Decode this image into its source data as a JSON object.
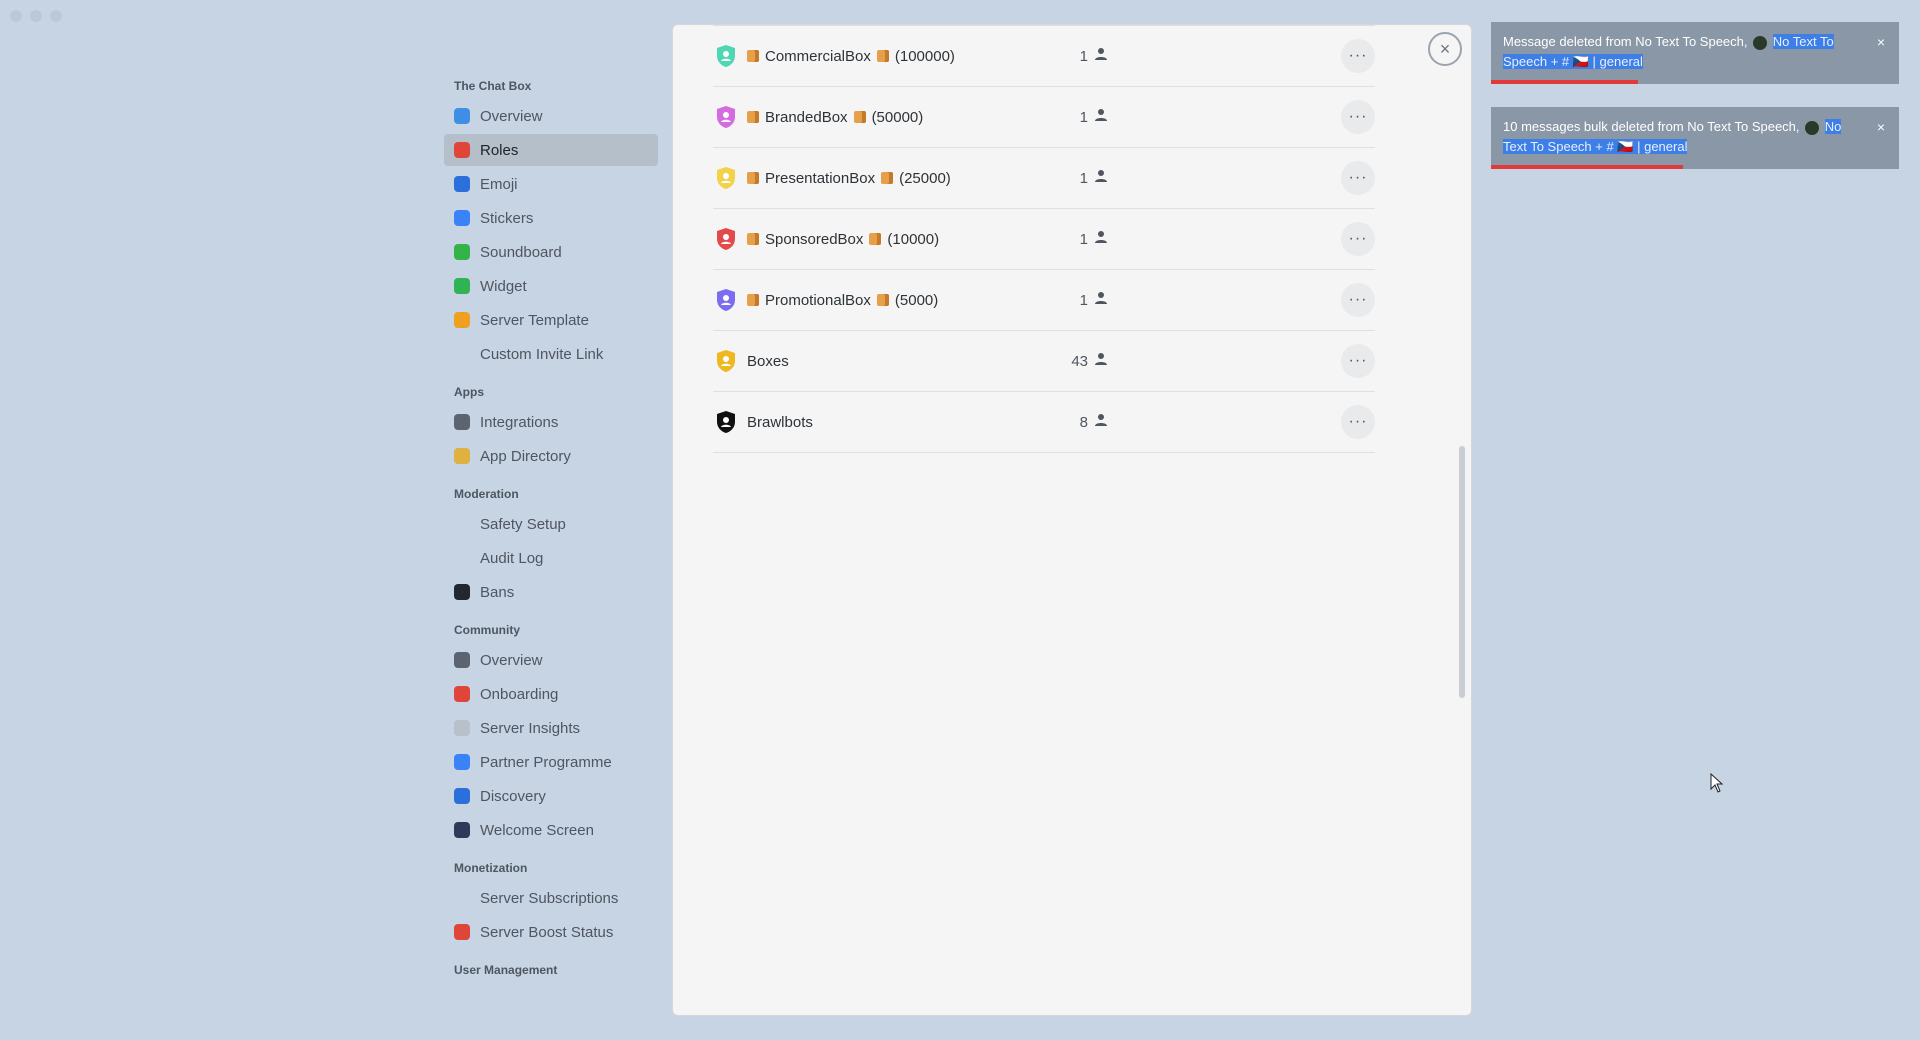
{
  "sidebar": {
    "sections": [
      {
        "title": "The Chat Box",
        "items": [
          {
            "label": "Overview",
            "icon": "cloud-icon",
            "color": "#3f8ee6"
          },
          {
            "label": "Roles",
            "icon": "roles-icon",
            "color": "#e0453a",
            "active": true
          },
          {
            "label": "Emoji",
            "icon": "emoji-icon",
            "color": "#2a6fdb"
          },
          {
            "label": "Stickers",
            "icon": "stickers-icon",
            "color": "#3b82f6"
          },
          {
            "label": "Soundboard",
            "icon": "soundboard-icon",
            "color": "#33b34a"
          },
          {
            "label": "Widget",
            "icon": "widget-icon",
            "color": "#2fb355"
          },
          {
            "label": "Server Template",
            "icon": "template-icon",
            "color": "#f0a020"
          },
          {
            "label": "Custom Invite Link",
            "icon": "",
            "color": ""
          }
        ]
      },
      {
        "title": "Apps",
        "items": [
          {
            "label": "Integrations",
            "icon": "integrations-icon",
            "color": "#5b6470"
          },
          {
            "label": "App Directory",
            "icon": "app-directory-icon",
            "color": "#e0b040"
          }
        ]
      },
      {
        "title": "Moderation",
        "items": [
          {
            "label": "Safety Setup",
            "icon": "",
            "color": ""
          },
          {
            "label": "Audit Log",
            "icon": "",
            "color": ""
          },
          {
            "label": "Bans",
            "icon": "bans-icon",
            "color": "#222831"
          }
        ]
      },
      {
        "title": "Community",
        "items": [
          {
            "label": "Overview",
            "icon": "community-overview-icon",
            "color": "#5b6470"
          },
          {
            "label": "Onboarding",
            "icon": "onboarding-icon",
            "color": "#e0453a"
          },
          {
            "label": "Server Insights",
            "icon": "insights-icon",
            "color": "#b8c0ca"
          },
          {
            "label": "Partner Programme",
            "icon": "partner-icon",
            "color": "#3b82f6"
          },
          {
            "label": "Discovery",
            "icon": "discovery-icon",
            "color": "#2a6fdb"
          },
          {
            "label": "Welcome Screen",
            "icon": "welcome-icon",
            "color": "#2f3a5a"
          }
        ]
      },
      {
        "title": "Monetization",
        "items": [
          {
            "label": "Server Subscriptions",
            "icon": "",
            "color": ""
          },
          {
            "label": "Server Boost Status",
            "icon": "boost-icon",
            "color": "#e0453a"
          }
        ]
      },
      {
        "title": "User Management",
        "items": []
      }
    ]
  },
  "roles": [
    {
      "name": "CommercialBox",
      "suffix": "(100000)",
      "boxes": true,
      "count": "1",
      "color": "#4fd6b5"
    },
    {
      "name": "BrandedBox",
      "suffix": "(50000)",
      "boxes": true,
      "count": "1",
      "color": "#d46be0"
    },
    {
      "name": "PresentationBox",
      "suffix": "(25000)",
      "boxes": true,
      "count": "1",
      "color": "#f2d24a"
    },
    {
      "name": "SponsoredBox",
      "suffix": "(10000)",
      "boxes": true,
      "count": "1",
      "color": "#e34b4b"
    },
    {
      "name": "PromotionalBox",
      "suffix": "(5000)",
      "boxes": true,
      "count": "1",
      "color": "#7b6cf0"
    },
    {
      "name": "Boxes",
      "suffix": "",
      "boxes": false,
      "count": "43",
      "color": "#f0b820"
    },
    {
      "name": "Brawlbots",
      "suffix": "",
      "boxes": false,
      "count": "8",
      "color": "#111111"
    }
  ],
  "toasts": [
    {
      "text": "Message deleted from No Text To Speech,",
      "highlight": "No Text To Speech + # 🇨🇿 | general",
      "progress": 0.36
    },
    {
      "text": "10 messages bulk deleted from No Text To Speech,",
      "highlight": "No Text To Speech + # 🇨🇿 | general",
      "progress": 0.47
    }
  ],
  "icons": {
    "close": "×",
    "more": "···"
  }
}
